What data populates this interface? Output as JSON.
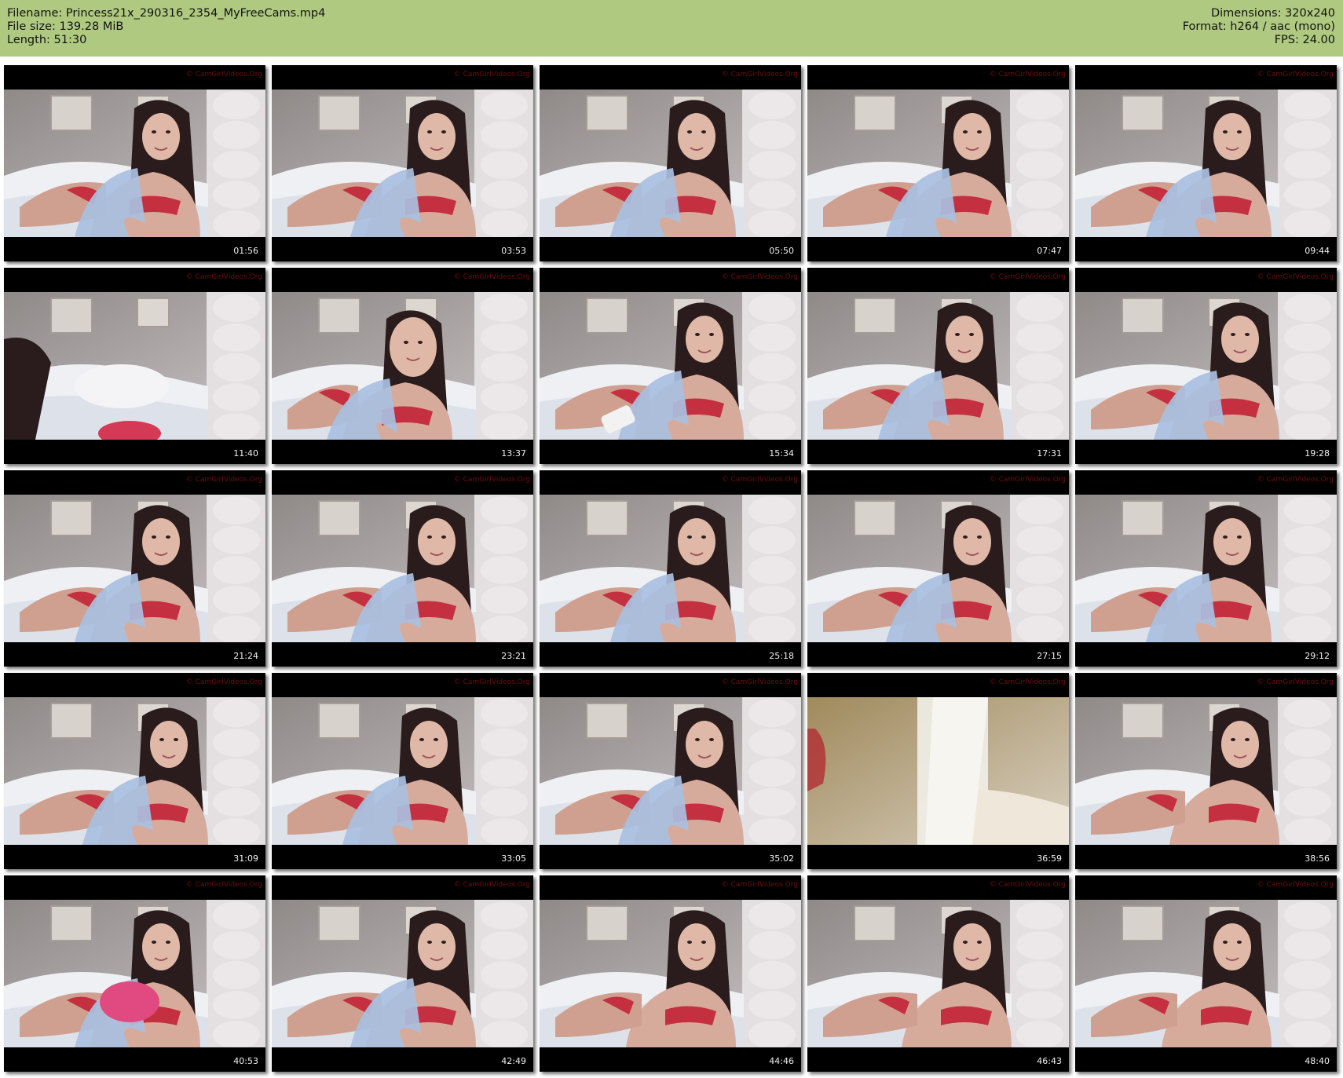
{
  "header": {
    "filename": "Filename: Princess21x_290316_2354_MyFreeCams.mp4",
    "file_size": "File size: 139.28 MiB",
    "length": "Length: 51:30",
    "dimensions": "Dimensions: 320x240",
    "format": "Format: h264 / aac (mono)",
    "fps": "FPS: 24.00"
  },
  "watermark_text": "© CamGirlVideos.Org",
  "colors": {
    "header_bg": "#afca80",
    "thumb_border": "#000000",
    "timestamp": "#f2f2f2"
  },
  "thumbnails": [
    {
      "time": "01:56",
      "scene": "room-bed-back"
    },
    {
      "time": "03:53",
      "scene": "lying-shirt"
    },
    {
      "time": "05:50",
      "scene": "lying-shirt"
    },
    {
      "time": "07:47",
      "scene": "lying-smile"
    },
    {
      "time": "09:44",
      "scene": "lying-hand"
    },
    {
      "time": "11:40",
      "scene": "room-bed-empty"
    },
    {
      "time": "13:37",
      "scene": "closeup"
    },
    {
      "time": "15:34",
      "scene": "lying-phone"
    },
    {
      "time": "17:31",
      "scene": "lying-shirt"
    },
    {
      "time": "19:28",
      "scene": "lying-shirt"
    },
    {
      "time": "21:24",
      "scene": "lying-shirt"
    },
    {
      "time": "23:21",
      "scene": "lying-shirt"
    },
    {
      "time": "25:18",
      "scene": "lying-shirt"
    },
    {
      "time": "27:15",
      "scene": "lying-shirt"
    },
    {
      "time": "29:12",
      "scene": "lying-shirt"
    },
    {
      "time": "31:09",
      "scene": "lying-shirt"
    },
    {
      "time": "33:05",
      "scene": "lying-smile"
    },
    {
      "time": "35:02",
      "scene": "lying-shirt"
    },
    {
      "time": "36:59",
      "scene": "blur-warm"
    },
    {
      "time": "38:56",
      "scene": "lying-lingerie"
    },
    {
      "time": "40:53",
      "scene": "lying-bowl"
    },
    {
      "time": "42:49",
      "scene": "room-bed-back"
    },
    {
      "time": "44:46",
      "scene": "lying-lingerie"
    },
    {
      "time": "46:43",
      "scene": "lying-lingerie"
    },
    {
      "time": "48:40",
      "scene": "lying-lingerie"
    }
  ]
}
